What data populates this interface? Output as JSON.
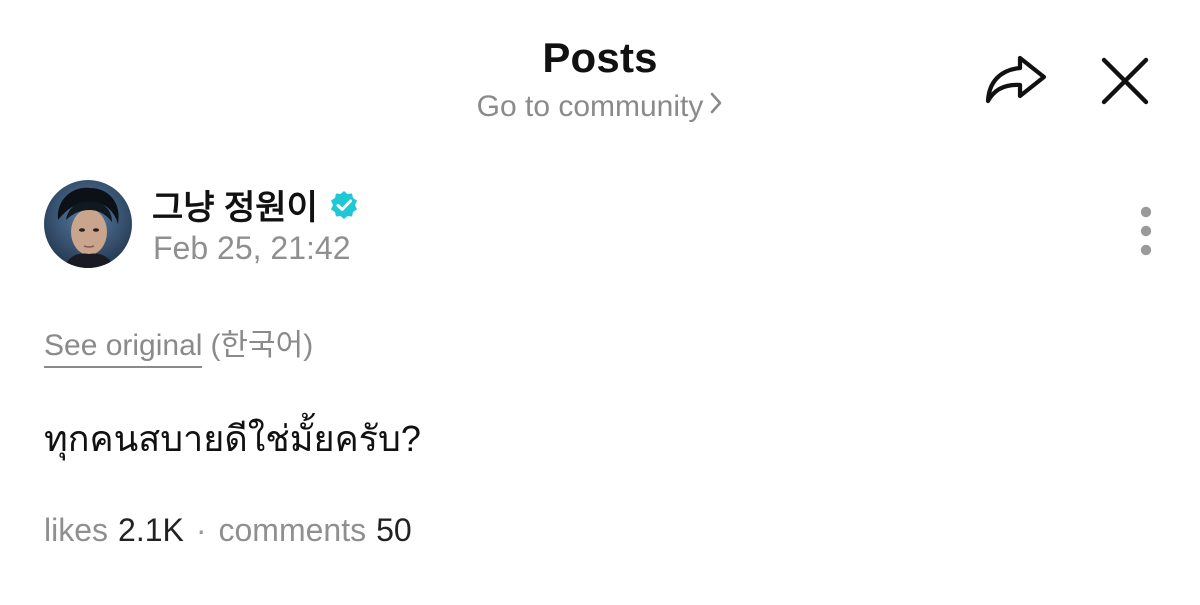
{
  "header": {
    "title": "Posts",
    "community_link": "Go to community",
    "share_icon": "share-arrow-icon",
    "close_icon": "close-icon"
  },
  "author": {
    "name": "그냥 정원이",
    "verified_icon": "verified-badge-icon",
    "verified_color": "#1ec8d6",
    "date": "Feb 25, 21:42",
    "more_icon": "more-vertical-icon"
  },
  "translation": {
    "see_original": "See original",
    "language": "(한국어)"
  },
  "post": {
    "text": "ทุกคนสบายดีใช่มั้ยครับ?"
  },
  "stats": {
    "likes_label": "likes",
    "likes_count": "2.1K",
    "separator": "·",
    "comments_label": "comments",
    "comments_count": "50"
  }
}
